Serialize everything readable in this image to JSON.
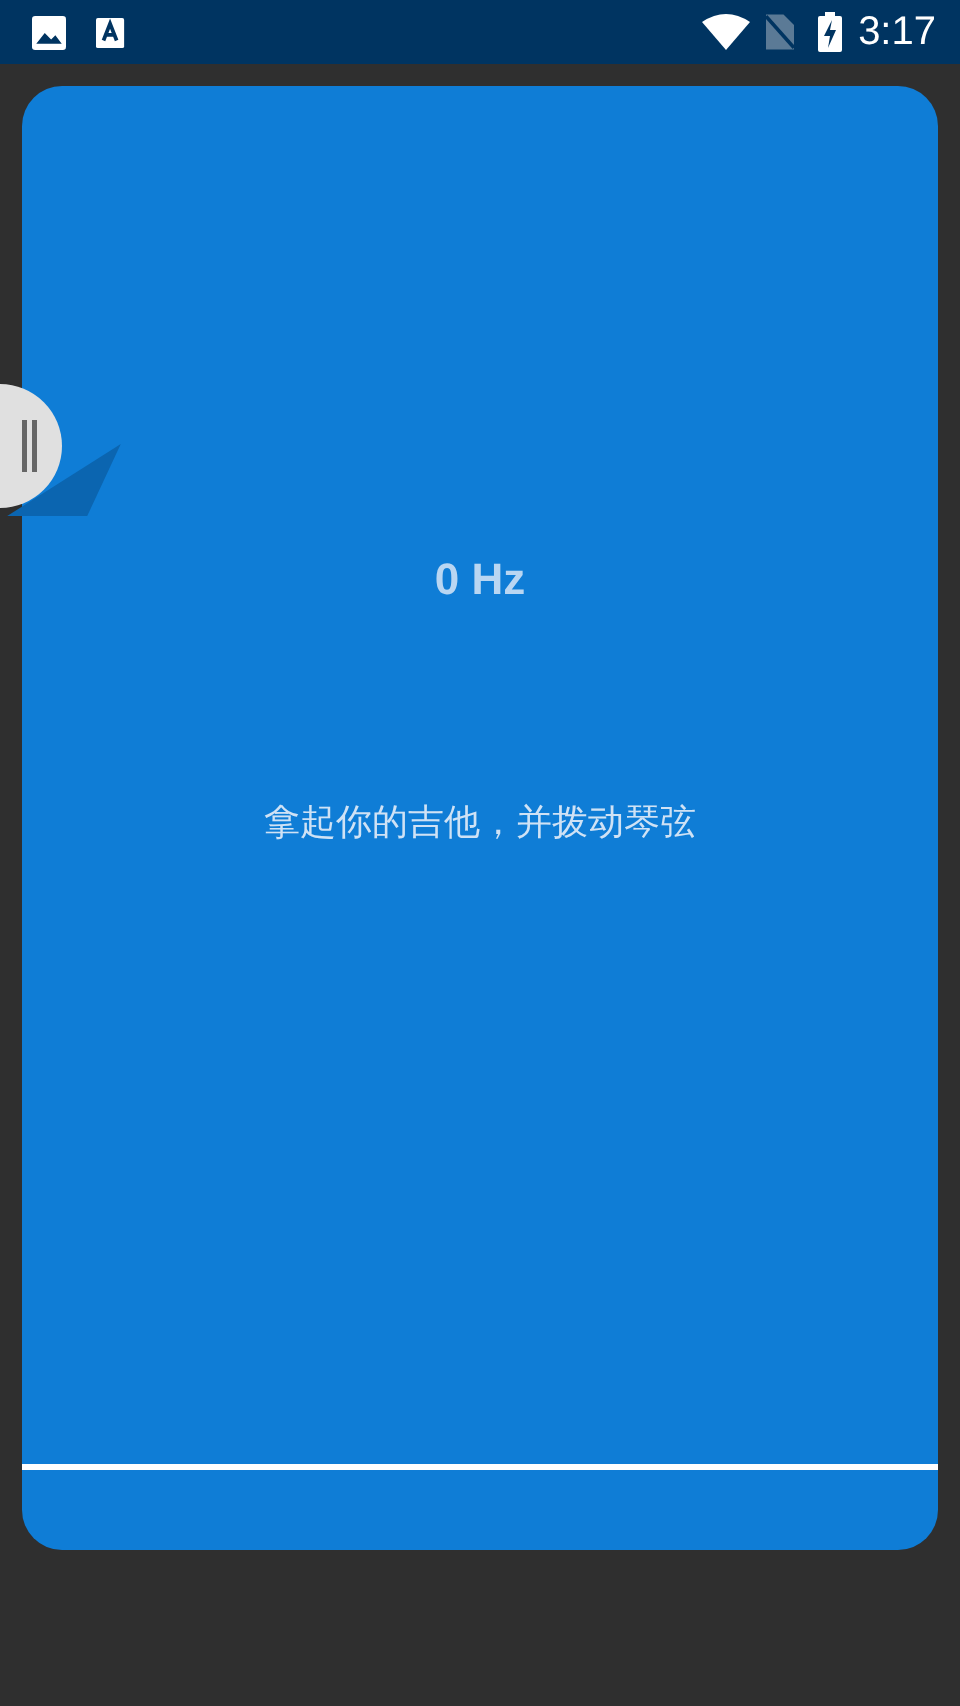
{
  "status_bar": {
    "time": "3:17"
  },
  "tuner": {
    "frequency": "0 Hz",
    "hint": "拿起你的吉他，并拨动琴弦"
  }
}
